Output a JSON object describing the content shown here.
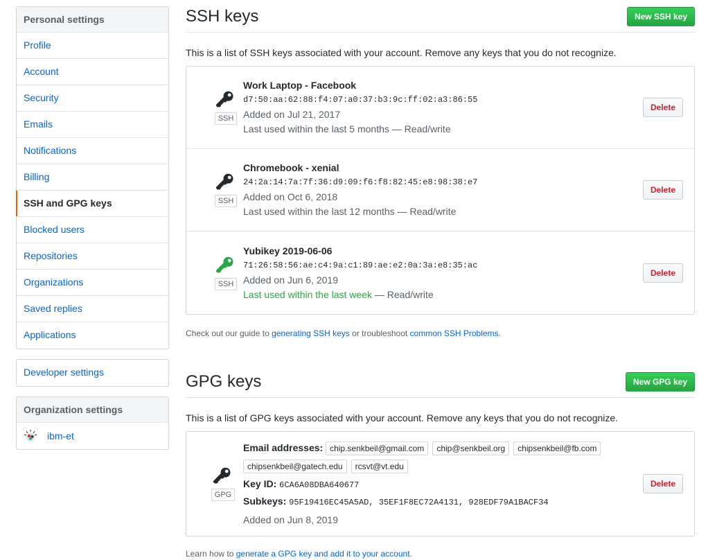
{
  "sidebar": {
    "personal_heading": "Personal settings",
    "items": [
      {
        "label": "Profile",
        "selected": false
      },
      {
        "label": "Account",
        "selected": false
      },
      {
        "label": "Security",
        "selected": false
      },
      {
        "label": "Emails",
        "selected": false
      },
      {
        "label": "Notifications",
        "selected": false
      },
      {
        "label": "Billing",
        "selected": false
      },
      {
        "label": "SSH and GPG keys",
        "selected": true
      },
      {
        "label": "Blocked users",
        "selected": false
      },
      {
        "label": "Repositories",
        "selected": false
      },
      {
        "label": "Organizations",
        "selected": false
      },
      {
        "label": "Saved replies",
        "selected": false
      },
      {
        "label": "Applications",
        "selected": false
      }
    ],
    "developer_settings": "Developer settings",
    "org_heading": "Organization settings",
    "orgs": [
      {
        "name": "ibm-et",
        "avatar_icon": "ibm-et-org-avatar"
      }
    ],
    "selected_accent": "#e36209"
  },
  "ssh": {
    "title": "SSH keys",
    "new_button": "New SSH key",
    "intro": "This is a list of SSH keys associated with your account. Remove any keys that you do not recognize.",
    "keys": [
      {
        "name": "Work Laptop - Facebook",
        "fingerprint": "d7:50:aa:62:88:f4:07:a0:37:b3:9c:ff:02:a3:86:55",
        "added": "Added on Jul 21, 2017",
        "last_used": "Last used within the last 5 months",
        "access": " — Read/write",
        "recent": false,
        "badge": "SSH",
        "icon": "key-icon",
        "delete": "Delete"
      },
      {
        "name": "Chromebook - xenial",
        "fingerprint": "24:2a:14:7a:7f:36:d9:09:f6:f8:82:45:e8:98:38:e7",
        "added": "Added on Oct 6, 2018",
        "last_used": "Last used within the last 12 months",
        "access": " — Read/write",
        "recent": false,
        "badge": "SSH",
        "icon": "key-icon",
        "delete": "Delete"
      },
      {
        "name": "Yubikey 2019-06-06",
        "fingerprint": "71:26:58:56:ae:c4:9a:c1:89:ae:e2:0a:3a:e8:35:ac",
        "added": "Added on Jun 6, 2019",
        "last_used": "Last used within the last week",
        "access": " — Read/write",
        "recent": true,
        "badge": "SSH",
        "icon": "key-icon",
        "delete": "Delete"
      }
    ],
    "help_prefix": "Check out our guide to ",
    "help_link1": "generating SSH keys",
    "help_middle": " or troubleshoot ",
    "help_link2": "common SSH Problems",
    "help_suffix": "."
  },
  "gpg": {
    "title": "GPG keys",
    "new_button": "New GPG key",
    "intro": "This is a list of GPG keys associated with your account. Remove any keys that you do not recognize.",
    "key": {
      "badge": "GPG",
      "emails_label": "Email addresses:",
      "emails": [
        "chip.senkbeil@gmail.com",
        "chip@senkbeil.org",
        "chipsenkbeil@fb.com",
        "chipsenkbeil@gatech.edu",
        "rcsvt@vt.edu"
      ],
      "key_id_label": "Key ID:",
      "key_id": "6CA6A08DBA640677",
      "subkeys_label": "Subkeys:",
      "subkeys": "95F19416EC45A5AD, 35EF1F8EC72A4131, 928EDF79A1BACF34",
      "added": "Added on Jun 8, 2019",
      "delete": "Delete"
    },
    "help_prefix": "Learn how to ",
    "help_link": "generate a GPG key and add it to your account",
    "help_suffix": "."
  },
  "colors": {
    "link": "#0366d6",
    "primary_green": "#28a745",
    "danger_red": "#cb2431",
    "key_dark": "#24292e",
    "key_recent": "#28a745"
  }
}
